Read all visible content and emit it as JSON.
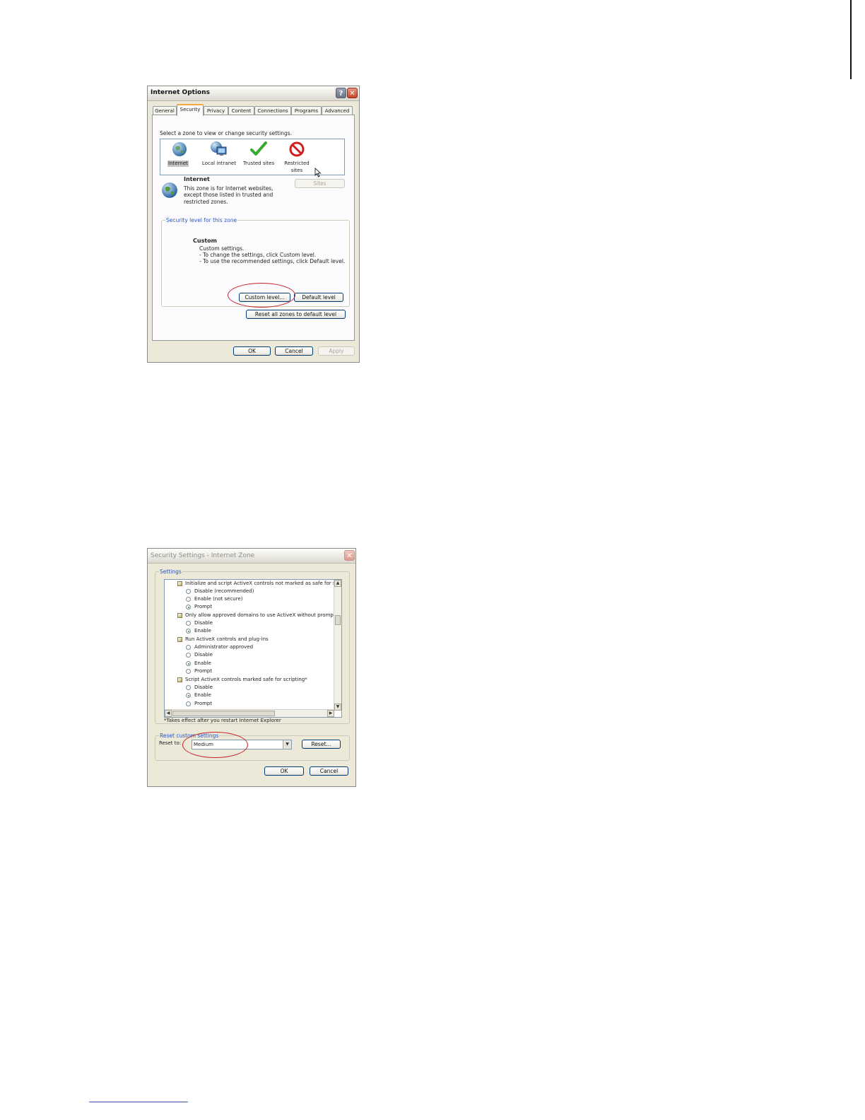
{
  "internet_options": {
    "title": "Internet Options",
    "help_glyph": "?",
    "close_glyph": "✕",
    "tabs": [
      {
        "label": "General"
      },
      {
        "label": "Security"
      },
      {
        "label": "Privacy"
      },
      {
        "label": "Content"
      },
      {
        "label": "Connections"
      },
      {
        "label": "Programs"
      },
      {
        "label": "Advanced"
      }
    ],
    "active_tab": "Security",
    "select_zone_prompt": "Select a zone to view or change security settings.",
    "zones": [
      {
        "label": "Internet",
        "icon": "globe-icon",
        "selected": true
      },
      {
        "label": "Local intranet",
        "icon": "intranet-icon"
      },
      {
        "label": "Trusted sites",
        "icon": "checkmark-icon"
      },
      {
        "label": "Restricted sites",
        "line1": "Restricted",
        "line2": "sites",
        "icon": "restricted-icon"
      }
    ],
    "zone_info": {
      "title": "Internet",
      "line1": "This zone is for Internet websites,",
      "line2": "except those listed in trusted and",
      "line3": "restricted zones."
    },
    "sites_button": "Sites",
    "security_level_legend": "Security level for this zone",
    "level": {
      "name": "Custom",
      "line1": "Custom settings.",
      "line2": "- To change the settings, click Custom level.",
      "line3": "- To use the recommended settings, click Default level."
    },
    "custom_level_button": "Custom level...",
    "default_level_button": "Default level",
    "reset_all_button": "Reset all zones to default level",
    "ok_button": "OK",
    "cancel_button": "Cancel",
    "apply_button": "Apply",
    "annotation_color": "#c8202a"
  },
  "security_settings": {
    "title": "Security Settings - Internet Zone",
    "close_glyph": "✕",
    "settings_legend": "Settings",
    "items": [
      {
        "text": "Initialize and script ActiveX controls not marked as safe for scripting",
        "kind": "header"
      },
      {
        "text": "Disable (recommended)",
        "kind": "radio",
        "checked": false
      },
      {
        "text": "Enable (not secure)",
        "kind": "radio",
        "checked": false
      },
      {
        "text": "Prompt",
        "kind": "radio",
        "checked": true
      },
      {
        "text": "Only allow approved domains to use ActiveX without prompt",
        "kind": "header"
      },
      {
        "text": "Disable",
        "kind": "radio",
        "checked": false
      },
      {
        "text": "Enable",
        "kind": "radio",
        "checked": true
      },
      {
        "text": "Run ActiveX controls and plug-ins",
        "kind": "header"
      },
      {
        "text": "Administrator approved",
        "kind": "radio",
        "checked": false
      },
      {
        "text": "Disable",
        "kind": "radio",
        "checked": false
      },
      {
        "text": "Enable",
        "kind": "radio",
        "checked": true
      },
      {
        "text": "Prompt",
        "kind": "radio",
        "checked": false
      },
      {
        "text": "Script ActiveX controls marked safe for scripting*",
        "kind": "header"
      },
      {
        "text": "Disable",
        "kind": "radio",
        "checked": false
      },
      {
        "text": "Enable",
        "kind": "radio",
        "checked": true
      },
      {
        "text": "Prompt",
        "kind": "radio",
        "checked": false
      }
    ],
    "footnote": "*Takes effect after you restart Internet Explorer",
    "reset_legend": "Reset custom settings",
    "reset_to_label": "Reset to:",
    "reset_to_value": "Medium",
    "reset_button": "Reset...",
    "ok_button": "OK",
    "cancel_button": "Cancel"
  }
}
